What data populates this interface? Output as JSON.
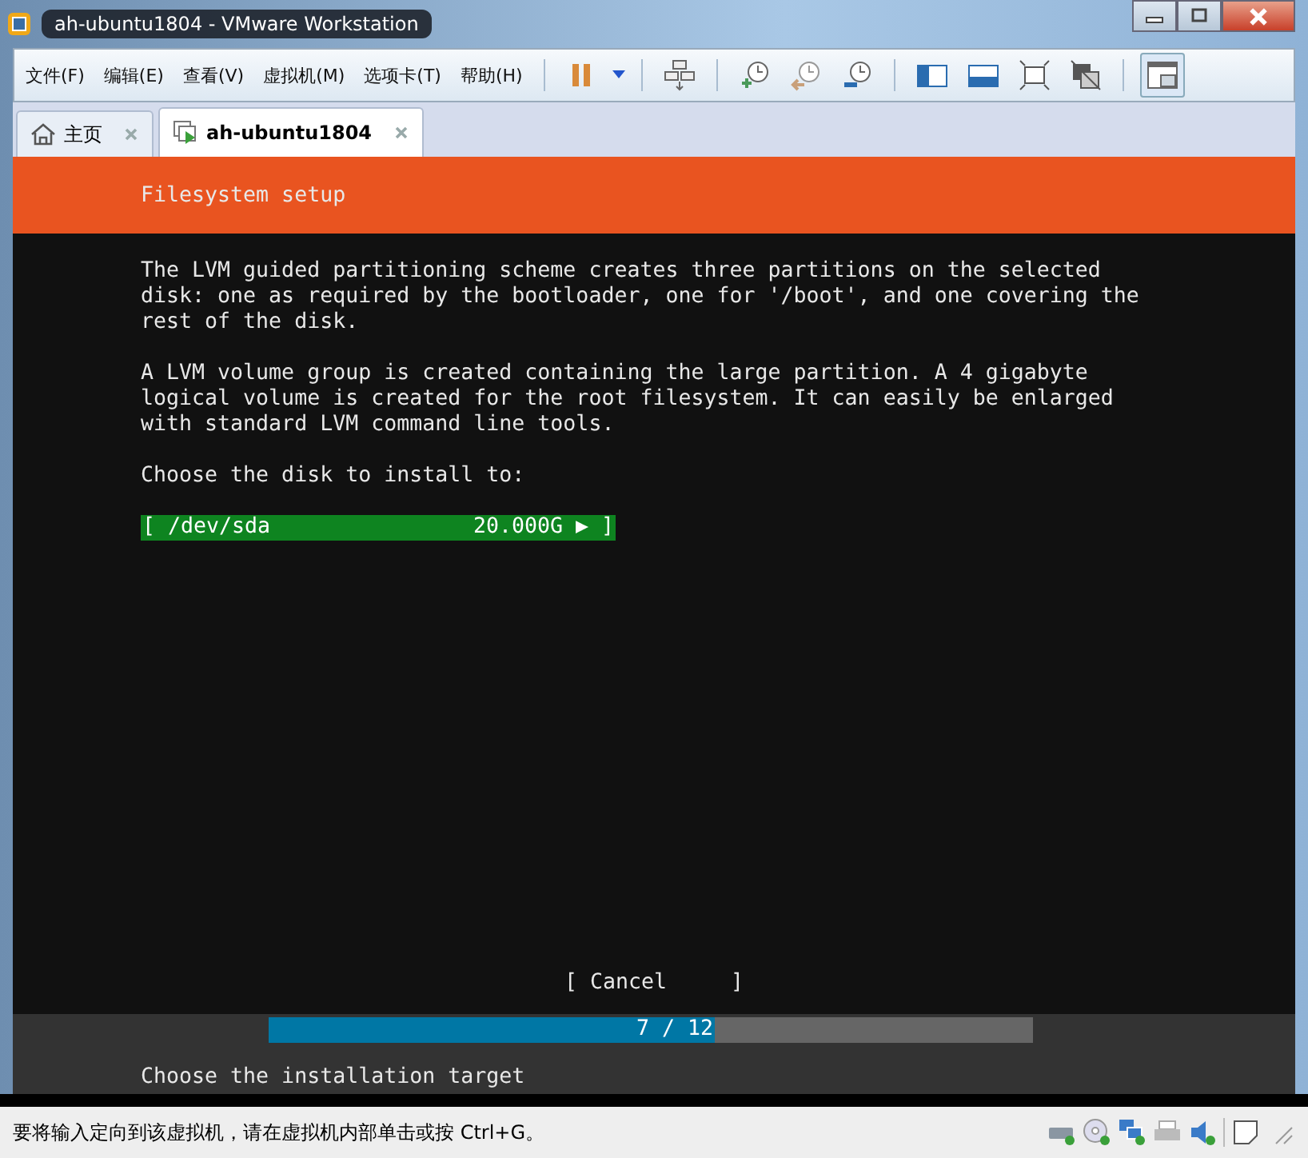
{
  "window": {
    "title": "ah-ubuntu1804 - VMware Workstation"
  },
  "menu": [
    "文件(F)",
    "编辑(E)",
    "查看(V)",
    "虚拟机(M)",
    "选项卡(T)",
    "帮助(H)"
  ],
  "tabs": [
    {
      "label": "主页",
      "kind": "home",
      "selected": false
    },
    {
      "label": "ah-ubuntu1804",
      "kind": "vm",
      "selected": true
    }
  ],
  "console": {
    "header": "Filesystem setup",
    "paragraphs": [
      "The LVM guided partitioning scheme creates three partitions on the selected\ndisk: one as required by the bootloader, one for '/boot', and one covering the\nrest of the disk.",
      "A LVM volume group is created containing the large partition. A 4 gigabyte\nlogical volume is created for the root filesystem. It can easily be enlarged\nwith standard LVM command line tools.",
      "Choose the disk to install to:"
    ],
    "disks": [
      {
        "name": "[ /dev/sda",
        "size": "20.000G ▶ ]",
        "selected": true
      }
    ],
    "cancel": "[ Cancel     ]",
    "progress": {
      "level": 0.583,
      "label": "7 / 12"
    },
    "footer": "Choose the installation target"
  },
  "status_bar": {
    "text": "要将输入定向到该虚拟机，请在虚拟机内部单击或按 Ctrl+G。"
  }
}
